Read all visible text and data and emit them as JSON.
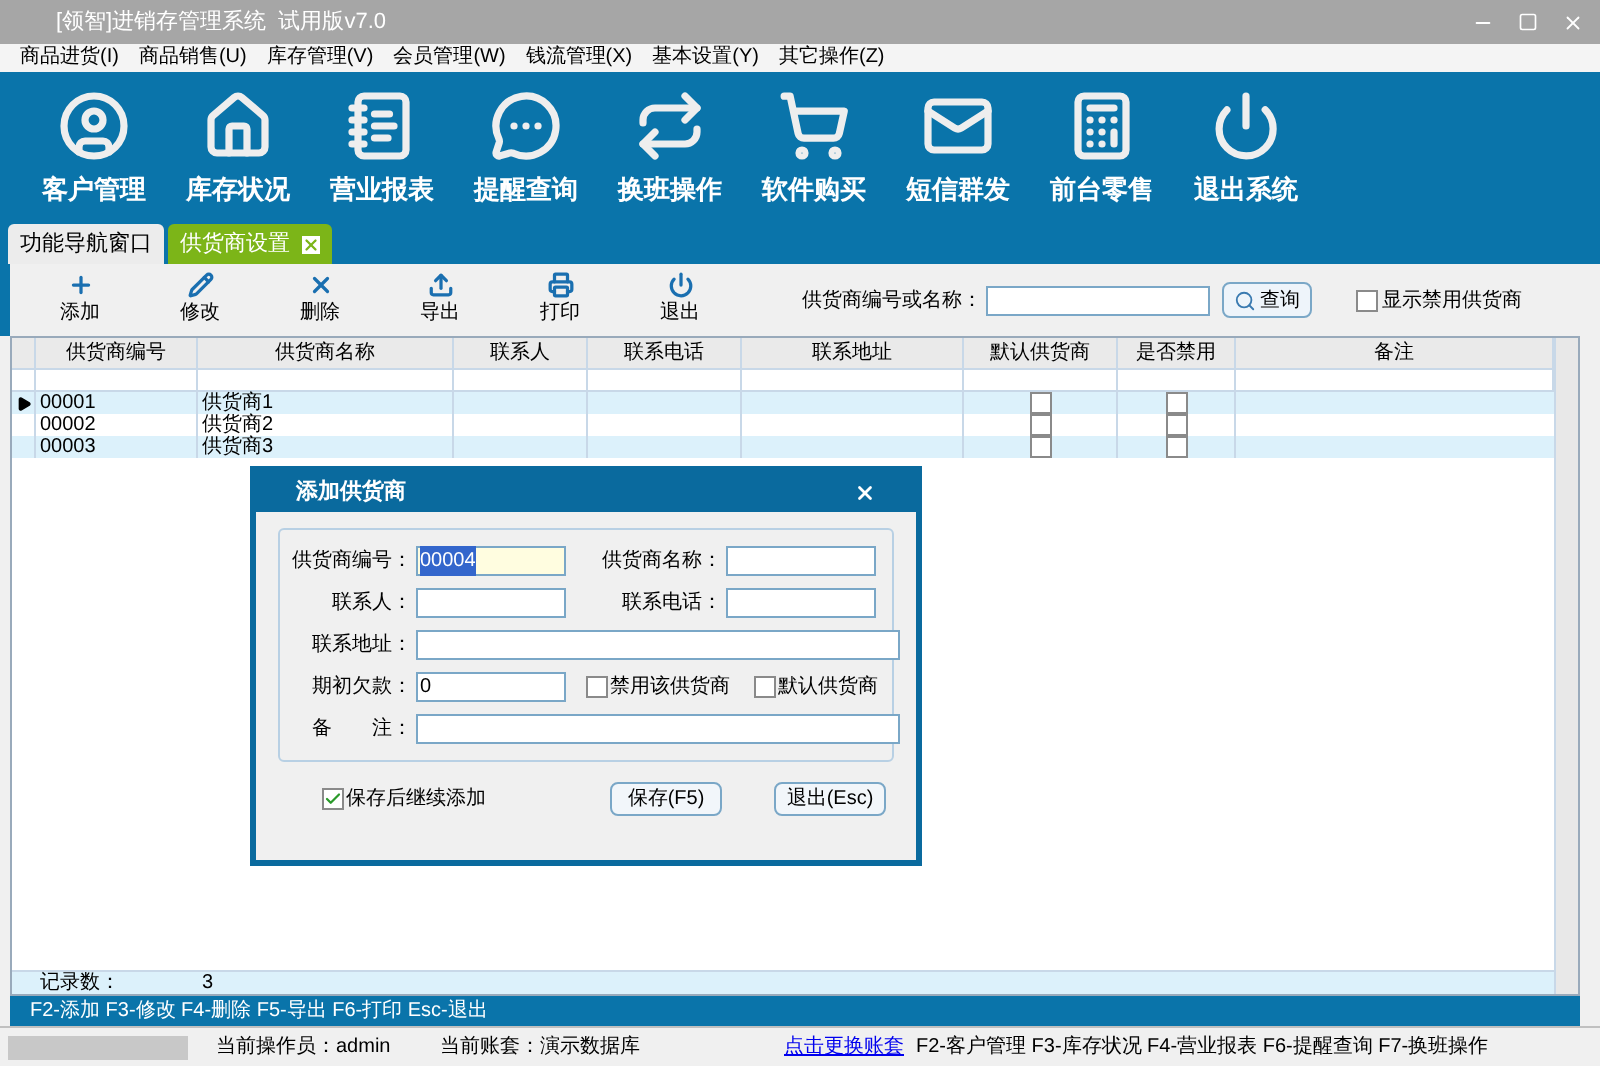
{
  "window": {
    "title": "[领智]进销存管理系统  试用版v7.0"
  },
  "menu": [
    "商品进货(I)",
    "商品销售(U)",
    "库存管理(V)",
    "会员管理(W)",
    "钱流管理(X)",
    "基本设置(Y)",
    "其它操作(Z)"
  ],
  "main_toolbar": [
    {
      "kind": "user",
      "label": "客户管理"
    },
    {
      "kind": "home",
      "label": "库存状况"
    },
    {
      "kind": "report",
      "label": "营业报表"
    },
    {
      "kind": "chat",
      "label": "提醒查询"
    },
    {
      "kind": "swap",
      "label": "换班操作"
    },
    {
      "kind": "cart",
      "label": "软件购买"
    },
    {
      "kind": "mail",
      "label": "短信群发"
    },
    {
      "kind": "register",
      "label": "前台零售"
    },
    {
      "kind": "power",
      "label": "退出系统"
    }
  ],
  "tabs": [
    {
      "label": "功能导航窗口",
      "selected": false,
      "closable": false
    },
    {
      "label": "供货商设置",
      "selected": true,
      "closable": true
    }
  ],
  "actions": [
    {
      "kind": "add",
      "label": "添加"
    },
    {
      "kind": "edit",
      "label": "修改"
    },
    {
      "kind": "delete",
      "label": "删除"
    },
    {
      "kind": "export",
      "label": "导出"
    },
    {
      "kind": "print",
      "label": "打印"
    },
    {
      "kind": "exit",
      "label": "退出"
    }
  ],
  "search": {
    "label": "供货商编号或名称：",
    "button": "查询"
  },
  "show_disabled": {
    "label": "显示禁用供货商",
    "checked": false
  },
  "table": {
    "columns": [
      "供货商编号",
      "供货商名称",
      "联系人",
      "联系电话",
      "联系地址",
      "默认供货商",
      "是否禁用",
      "备注"
    ],
    "rows": [
      {
        "code": "00001",
        "name": "供货商1",
        "current": true,
        "is_default": false,
        "disabled": false
      },
      {
        "code": "00002",
        "name": "供货商2",
        "current": false,
        "is_default": false,
        "disabled": false
      },
      {
        "code": "00003",
        "name": "供货商3",
        "current": false,
        "is_default": false,
        "disabled": false
      }
    ],
    "footer": {
      "label": "记录数：",
      "value": "3"
    }
  },
  "hint_bar": "F2-添加 F3-修改 F4-删除 F5-导出 F6-打印 Esc-退出",
  "status_bar": {
    "operator": "当前操作员：admin",
    "account": "当前账套：演示数据库",
    "link": "点击更换账套",
    "shortcuts": "F2-客户管理 F3-库存状况 F4-营业报表 F6-提醒查询 F7-换班操作"
  },
  "dialog": {
    "title": "添加供货商",
    "rows": [
      [
        {
          "kind": "field",
          "label": "供货商编号：",
          "value": "00004",
          "focused": true
        },
        {
          "kind": "field",
          "label": "供货商名称："
        }
      ],
      [
        {
          "kind": "field",
          "label": "联系人：",
          "focused": false
        },
        {
          "kind": "field",
          "label": "联系电话："
        }
      ],
      [
        {
          "kind": "wide",
          "label": "联系地址："
        }
      ],
      [
        {
          "kind": "field",
          "label": "期初欠款：",
          "value": "0",
          "focused": false
        },
        {
          "kind": "checkbox",
          "label": "禁用该供货商",
          "checked": false
        },
        {
          "kind": "checkbox",
          "label": "默认供货商",
          "checked": false
        }
      ],
      [
        {
          "kind": "wide",
          "label": "备　　注："
        }
      ]
    ],
    "continue": {
      "label": "保存后继续添加",
      "checked": true
    },
    "buttons": [
      "保存(F5)",
      "退出(Esc)"
    ]
  }
}
